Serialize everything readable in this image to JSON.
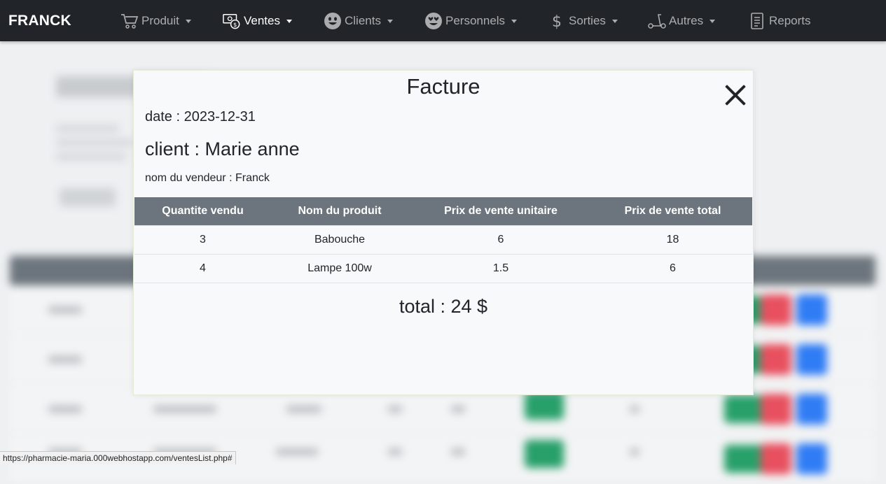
{
  "brand": "FRANCK",
  "nav": [
    {
      "label": "Produit",
      "icon": "cart-icon",
      "dropdown": true
    },
    {
      "label": "Ventes",
      "icon": "money-icon",
      "dropdown": true,
      "active": true
    },
    {
      "label": "Clients",
      "icon": "smiley-icon",
      "dropdown": true
    },
    {
      "label": "Personnels",
      "icon": "heart-eyes-icon",
      "dropdown": true
    },
    {
      "label": "Sorties",
      "icon": "dollar-icon",
      "dropdown": true
    },
    {
      "label": "Autres",
      "icon": "scooter-icon",
      "dropdown": true
    },
    {
      "label": "Reports",
      "icon": "document-icon",
      "dropdown": false
    }
  ],
  "modal": {
    "title": "Facture",
    "date": "date : 2023-12-31",
    "client": "client : Marie anne",
    "seller": "nom du vendeur : Franck",
    "columns": [
      "Quantite vendu",
      "Nom du produit",
      "Prix de vente unitaire",
      "Prix de vente total"
    ],
    "rows": [
      [
        "3",
        "Babouche",
        "6",
        "18"
      ],
      [
        "4",
        "Lampe 100w",
        "1.5",
        "6"
      ]
    ],
    "total": "total : 24 $"
  },
  "status_url": "https://pharmacie-maria.000webhostapp.com/ventesList.php#",
  "colors": {
    "navbar": "#212529",
    "table_header": "#6c757d",
    "modal_bg": "#f8f9fa"
  }
}
